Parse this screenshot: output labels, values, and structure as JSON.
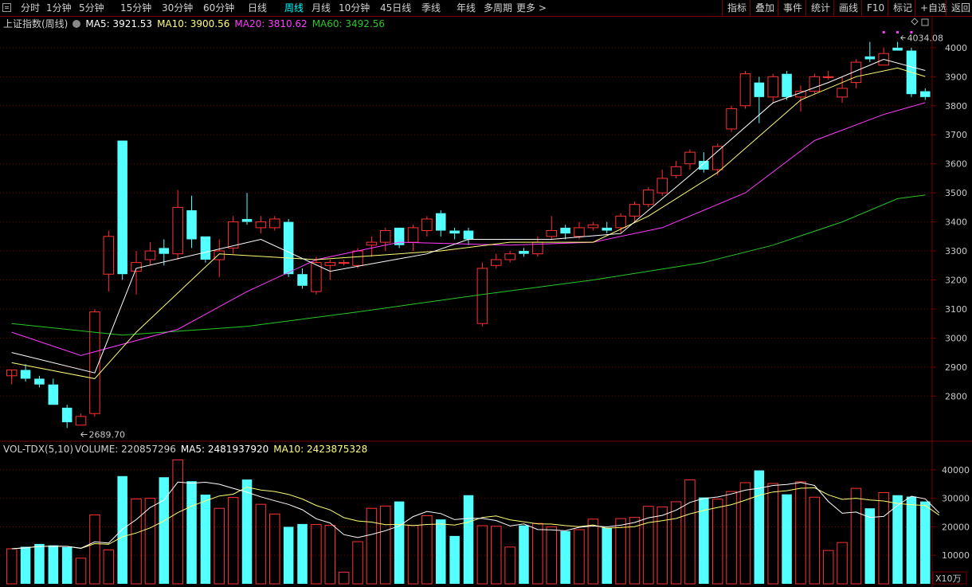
{
  "toolbar": {
    "periods": [
      {
        "label": "分时"
      },
      {
        "label": "1分钟"
      },
      {
        "label": "5分钟"
      },
      {
        "label": "15分钟"
      },
      {
        "label": "30分钟"
      },
      {
        "label": "60分钟"
      },
      {
        "label": "日线"
      },
      {
        "label": "周线",
        "active": true
      },
      {
        "label": "月线"
      },
      {
        "label": "10分钟"
      },
      {
        "label": "45日线"
      },
      {
        "label": "季线"
      },
      {
        "label": "年线"
      },
      {
        "label": "多周期"
      },
      {
        "label": "更多 >"
      }
    ],
    "right_buttons": [
      "指标",
      "叠加",
      "事件",
      "统计",
      "画线",
      "F10",
      "标记",
      "+自选",
      "返回"
    ]
  },
  "main_info": {
    "title": "上证指数(周线)",
    "ma5": "MA5: 3921.53",
    "ma10": "MA10: 3900.56",
    "ma20": "MA20: 3810.62",
    "ma60": "MA60: 3492.56"
  },
  "vol_info": {
    "title": "VOL-TDX(5,10)",
    "volume": "VOLUME: 220857296",
    "ma5": "MA5: 2481937920",
    "ma10": "MA10: 2423875328"
  },
  "annotations": {
    "high": "4034.08",
    "low": "2689.70",
    "vol_unit": "X10万"
  },
  "colors": {
    "up": "#ff3232",
    "down": "#54ffff",
    "ma5": "#ffffff",
    "ma10": "#ffff78",
    "ma20": "#ff3cff",
    "ma60": "#28c828",
    "grid": "#7a0000"
  },
  "chart_data": [
    {
      "type": "candlestick",
      "title": "上证指数(周线)",
      "yticks": [
        2800,
        2900,
        3000,
        3100,
        3200,
        3300,
        3400,
        3500,
        3600,
        3700,
        3800,
        3900,
        4000
      ],
      "ylim": [
        2650,
        4060
      ],
      "candles": [
        [
          2870,
          2890,
          2860,
          2840
        ],
        [
          2890,
          2860,
          2910,
          2850
        ],
        [
          2860,
          2840,
          2870,
          2830
        ],
        [
          2840,
          2770,
          2860,
          2770
        ],
        [
          2760,
          2710,
          2770,
          2690
        ],
        [
          2700,
          2730,
          2740,
          2700
        ],
        [
          2740,
          3090,
          3100,
          2730
        ],
        [
          3220,
          3350,
          3370,
          3160
        ],
        [
          3680,
          3220,
          3680,
          3200
        ],
        [
          3230,
          3260,
          3300,
          3150
        ],
        [
          3270,
          3300,
          3330,
          3250
        ],
        [
          3310,
          3290,
          3340,
          3250
        ],
        [
          3290,
          3450,
          3510,
          3270
        ],
        [
          3440,
          3340,
          3490,
          3310
        ],
        [
          3350,
          3270,
          3350,
          3260
        ],
        [
          3270,
          3300,
          3340,
          3210
        ],
        [
          3310,
          3400,
          3420,
          3290
        ],
        [
          3410,
          3400,
          3500,
          3390
        ],
        [
          3380,
          3400,
          3420,
          3360
        ],
        [
          3380,
          3410,
          3420,
          3370
        ],
        [
          3400,
          3220,
          3410,
          3210
        ],
        [
          3220,
          3180,
          3240,
          3170
        ],
        [
          3160,
          3260,
          3280,
          3150
        ],
        [
          3250,
          3260,
          3270,
          3200
        ],
        [
          3260,
          3260,
          3270,
          3250
        ],
        [
          3250,
          3300,
          3310,
          3240
        ],
        [
          3320,
          3330,
          3350,
          3280
        ],
        [
          3330,
          3370,
          3380,
          3300
        ],
        [
          3380,
          3320,
          3380,
          3310
        ],
        [
          3330,
          3380,
          3390,
          3300
        ],
        [
          3370,
          3410,
          3420,
          3350
        ],
        [
          3430,
          3370,
          3440,
          3350
        ],
        [
          3370,
          3360,
          3380,
          3340
        ],
        [
          3370,
          3340,
          3380,
          3320
        ],
        [
          3050,
          3240,
          3260,
          3040
        ],
        [
          3250,
          3270,
          3290,
          3240
        ],
        [
          3270,
          3290,
          3300,
          3260
        ],
        [
          3300,
          3290,
          3310,
          3280
        ],
        [
          3290,
          3330,
          3350,
          3280
        ],
        [
          3350,
          3370,
          3420,
          3340
        ],
        [
          3380,
          3360,
          3390,
          3340
        ],
        [
          3350,
          3380,
          3400,
          3340
        ],
        [
          3380,
          3390,
          3400,
          3370
        ],
        [
          3380,
          3370,
          3400,
          3360
        ],
        [
          3380,
          3420,
          3430,
          3360
        ],
        [
          3420,
          3460,
          3470,
          3400
        ],
        [
          3460,
          3510,
          3520,
          3450
        ],
        [
          3500,
          3550,
          3580,
          3490
        ],
        [
          3560,
          3590,
          3610,
          3550
        ],
        [
          3600,
          3640,
          3650,
          3580
        ],
        [
          3610,
          3580,
          3640,
          3570
        ],
        [
          3580,
          3660,
          3670,
          3560
        ],
        [
          3720,
          3790,
          3800,
          3710
        ],
        [
          3800,
          3910,
          3920,
          3790
        ],
        [
          3880,
          3830,
          3900,
          3740
        ],
        [
          3830,
          3900,
          3910,
          3810
        ],
        [
          3910,
          3830,
          3920,
          3820
        ],
        [
          3830,
          3850,
          3870,
          3780
        ],
        [
          3850,
          3900,
          3910,
          3840
        ],
        [
          3900,
          3900,
          3920,
          3890
        ],
        [
          3830,
          3860,
          3900,
          3810
        ],
        [
          3880,
          3950,
          3960,
          3860
        ],
        [
          3970,
          3960,
          4020,
          3950
        ],
        [
          3940,
          3980,
          4000,
          3940
        ],
        [
          4000,
          3990,
          4020,
          3990
        ],
        [
          3990,
          3840,
          4000,
          3830
        ],
        [
          3850,
          3830,
          3860,
          3820
        ]
      ],
      "ma5": [
        [
          0,
          2950
        ],
        [
          6,
          2880
        ],
        [
          9,
          3240
        ],
        [
          18,
          3340
        ],
        [
          23,
          3230
        ],
        [
          30,
          3290
        ],
        [
          33,
          3340
        ],
        [
          39,
          3340
        ],
        [
          44,
          3360
        ],
        [
          49,
          3560
        ],
        [
          55,
          3810
        ],
        [
          59,
          3880
        ],
        [
          63,
          3960
        ],
        [
          66,
          3921.53
        ]
      ],
      "ma10": [
        [
          0,
          2915
        ],
        [
          6,
          2860
        ],
        [
          9,
          3020
        ],
        [
          15,
          3290
        ],
        [
          22,
          3270
        ],
        [
          31,
          3300
        ],
        [
          36,
          3330
        ],
        [
          42,
          3330
        ],
        [
          46,
          3420
        ],
        [
          51,
          3570
        ],
        [
          57,
          3820
        ],
        [
          61,
          3900
        ],
        [
          64,
          3930
        ],
        [
          66,
          3900.56
        ]
      ],
      "ma20": [
        [
          0,
          3020
        ],
        [
          5,
          2940
        ],
        [
          12,
          3030
        ],
        [
          17,
          3160
        ],
        [
          22,
          3270
        ],
        [
          28,
          3330
        ],
        [
          36,
          3320
        ],
        [
          42,
          3330
        ],
        [
          47,
          3380
        ],
        [
          53,
          3500
        ],
        [
          58,
          3680
        ],
        [
          63,
          3770
        ],
        [
          66,
          3810.62
        ]
      ],
      "ma60": [
        [
          0,
          3050
        ],
        [
          8,
          3010
        ],
        [
          17,
          3040
        ],
        [
          25,
          3090
        ],
        [
          34,
          3150
        ],
        [
          42,
          3200
        ],
        [
          50,
          3260
        ],
        [
          55,
          3320
        ],
        [
          60,
          3400
        ],
        [
          64,
          3480
        ],
        [
          66,
          3492.56
        ]
      ]
    },
    {
      "type": "bar",
      "title": "VOL-TDX(5,10)",
      "yticks": [
        10000,
        20000,
        30000,
        40000
      ],
      "ylim": [
        0,
        45000
      ],
      "unit": "X10万",
      "values": [
        12300,
        13000,
        14000,
        13500,
        12900,
        9000,
        24200,
        11900,
        37800,
        29800,
        30000,
        37400,
        43500,
        36000,
        31300,
        26500,
        30300,
        36600,
        27900,
        24500,
        20000,
        21000,
        20800,
        20500,
        4100,
        14800,
        26500,
        27300,
        28900,
        20500,
        23900,
        22600,
        16800,
        31100,
        20400,
        20200,
        12900,
        20500,
        21200,
        20000,
        18500,
        19000,
        22700,
        19700,
        22900,
        23300,
        27200,
        27000,
        28800,
        36500,
        30300,
        29700,
        32400,
        35500,
        39800,
        35200,
        31400,
        35800,
        30400,
        11700,
        14500,
        33500,
        26500,
        32000,
        31100,
        30600,
        28900,
        2100
      ]
    }
  ]
}
